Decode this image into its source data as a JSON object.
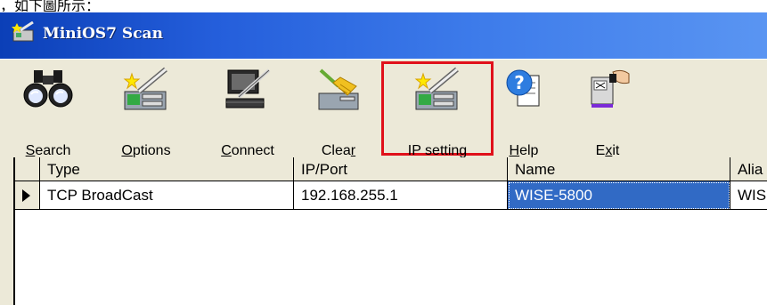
{
  "caption_text": "，如下圖所示：",
  "window": {
    "title": "MiniOS7 Scan"
  },
  "toolbar": {
    "buttons": [
      {
        "id": "search",
        "label_pre": "",
        "label_u": "S",
        "label_post": "earch",
        "icon": "binoculars-icon"
      },
      {
        "id": "options",
        "label_pre": "",
        "label_u": "O",
        "label_post": "ptions",
        "icon": "module-wand-icon"
      },
      {
        "id": "connect",
        "label_pre": "",
        "label_u": "C",
        "label_post": "onnect",
        "icon": "computer-connect-icon"
      },
      {
        "id": "clear",
        "label_pre": "Clea",
        "label_u": "r",
        "label_post": "",
        "icon": "broom-icon"
      },
      {
        "id": "ip_setting",
        "label_pre": "IP setting",
        "label_u": "",
        "label_post": "",
        "icon": "module-wand-icon"
      },
      {
        "id": "help",
        "label_pre": "",
        "label_u": "H",
        "label_post": "elp",
        "icon": "help-book-icon"
      },
      {
        "id": "exit",
        "label_pre": "E",
        "label_u": "x",
        "label_post": "it",
        "icon": "exit-door-icon"
      }
    ],
    "highlight_color": "#e0101a"
  },
  "table": {
    "columns": [
      "Type",
      "IP/Port",
      "Name",
      "Alia"
    ],
    "rows": [
      {
        "type": "TCP BroadCast",
        "ip": "192.168.255.1",
        "name": "WISE-5800",
        "alias": "WIS"
      }
    ],
    "selected_color": "#316ac5"
  }
}
